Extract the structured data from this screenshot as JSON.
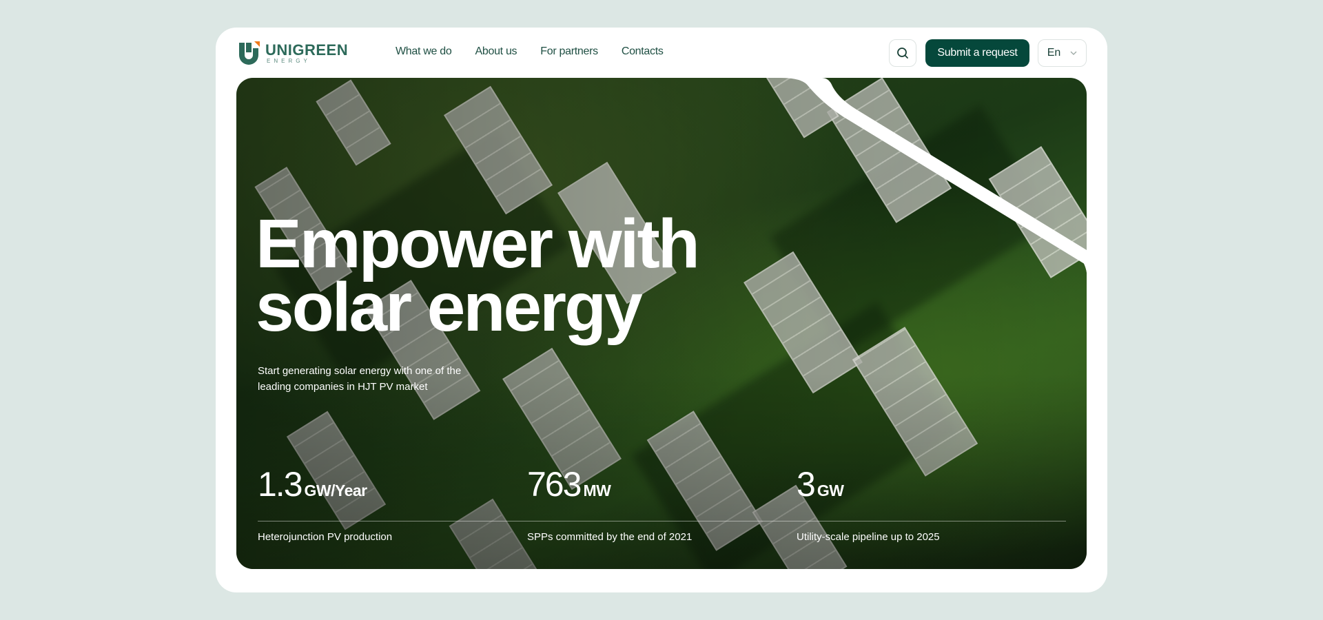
{
  "brand": {
    "name": "UNIGREEN",
    "sub": "ENERGY",
    "colors": {
      "primary": "#05483b",
      "accent": "#f07a1a",
      "logo": "#2d6a5a"
    }
  },
  "nav": {
    "items": [
      "What we do",
      "About us",
      "For partners",
      "Contacts"
    ]
  },
  "header": {
    "search_icon": "search-icon",
    "submit_label": "Submit a request",
    "language": "En"
  },
  "hero": {
    "title_line1": "Empower with",
    "title_line2": "solar energy",
    "subtitle": "Start generating solar energy with one of the leading companies in HJT PV market"
  },
  "stats": [
    {
      "value": "1.3",
      "unit": "GW/Year",
      "label": "Heterojunction PV production"
    },
    {
      "value": "763",
      "unit": "MW",
      "label": "SPPs committed by the end of 2021"
    },
    {
      "value": "3",
      "unit": "GW",
      "label": "Utility-scale pipeline up to 2025"
    }
  ]
}
